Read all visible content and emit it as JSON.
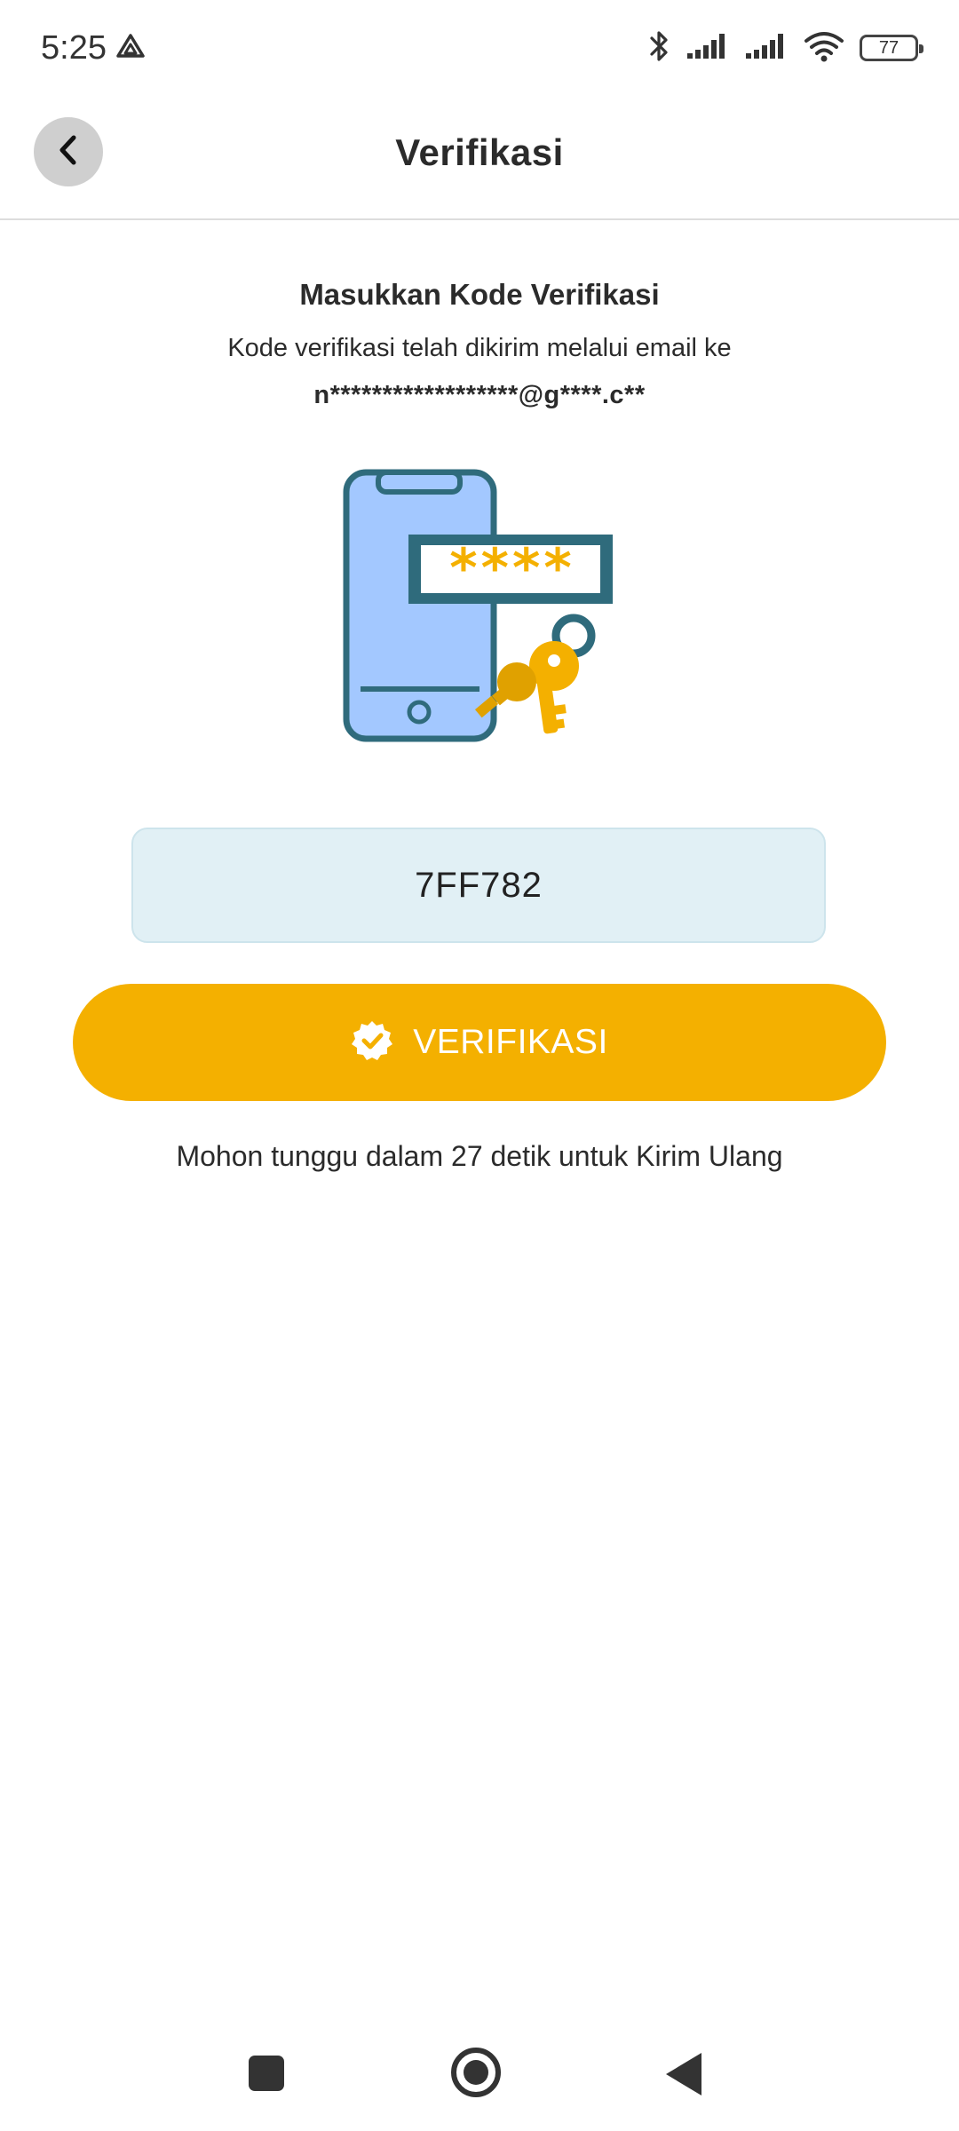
{
  "status_bar": {
    "time": "5:25",
    "battery_level": "77",
    "icons": [
      "drive-icon",
      "bluetooth-icon",
      "signal-icon",
      "signal-icon",
      "wifi-icon",
      "battery-icon"
    ]
  },
  "app_bar": {
    "title": "Verifikasi",
    "back_icon": "chevron-left-icon"
  },
  "content": {
    "heading": "Masukkan Kode Verifikasi",
    "subtitle": "Kode verifikasi telah dikirim melalui email ke",
    "email": "n******************@g****.c**",
    "illustration": "phone-password-key-illustration",
    "code_value": "7FF782",
    "verify_button_label": "VERIFIKASI",
    "verify_icon": "verified-badge-icon",
    "resend_text": "Mohon tunggu dalam 27 detik untuk Kirim Ulang"
  },
  "colors": {
    "accent": "#f4b000",
    "input_bg": "#e1f0f5",
    "phone_blue": "#a3c8ff",
    "phone_outline": "#2f6b7c"
  },
  "nav_bar": {
    "items": [
      "recent-apps-icon",
      "home-icon",
      "back-icon"
    ]
  }
}
